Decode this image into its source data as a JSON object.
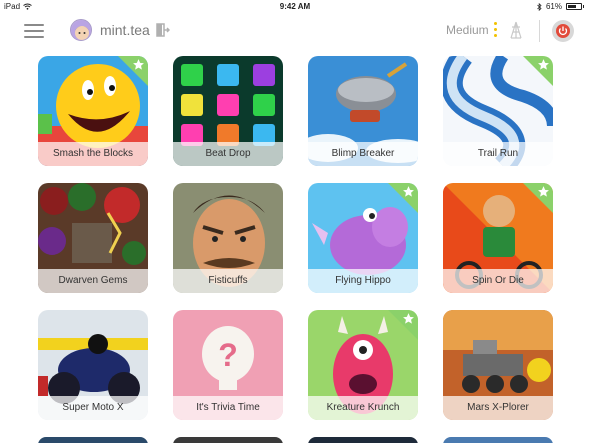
{
  "status_bar": {
    "device": "iPad",
    "time": "9:42 AM",
    "battery": "61%"
  },
  "header": {
    "username": "mint.tea",
    "difficulty": "Medium"
  },
  "games": [
    {
      "title": "Smash the Blocks",
      "favorite": true
    },
    {
      "title": "Beat Drop",
      "favorite": false
    },
    {
      "title": "Blimp Breaker",
      "favorite": false
    },
    {
      "title": "Trail Run",
      "favorite": true
    },
    {
      "title": "Dwarven Gems",
      "favorite": false
    },
    {
      "title": "Fisticuffs",
      "favorite": false
    },
    {
      "title": "Flying Hippo",
      "favorite": true
    },
    {
      "title": "Spin Or Die",
      "favorite": true
    },
    {
      "title": "Super Moto X",
      "favorite": false
    },
    {
      "title": "It's Trivia Time",
      "favorite": false
    },
    {
      "title": "Kreature Krunch",
      "favorite": true
    },
    {
      "title": "Mars X-Plorer",
      "favorite": false
    }
  ],
  "colors": {
    "favorite_badge": "#8bd16a",
    "accent": "#f2c200",
    "power": "#e24a3a"
  }
}
